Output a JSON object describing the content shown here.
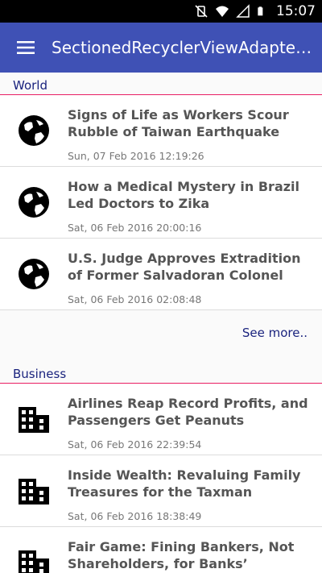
{
  "status_bar": {
    "time": "15:07"
  },
  "app_bar": {
    "title": "SectionedRecyclerViewAdapter..."
  },
  "sections": [
    {
      "title": "World",
      "icon": "globe-icon",
      "items": [
        {
          "title": "Signs of Life as Workers Scour Rubble of Taiwan Earthquake",
          "date": "Sun, 07 Feb 2016 12:19:26"
        },
        {
          "title": "How a Medical Mystery in Brazil Led Doctors to Zika",
          "date": "Sat, 06 Feb 2016 20:00:16"
        },
        {
          "title": "U.S. Judge Approves Extradition of Former Salvadoran Colonel",
          "date": "Sat, 06 Feb 2016 02:08:48"
        }
      ],
      "footer": "See more.."
    },
    {
      "title": "Business",
      "icon": "building-icon",
      "items": [
        {
          "title": "Airlines Reap Record Profits, and Passengers Get Peanuts",
          "date": "Sat, 06 Feb 2016 22:39:54"
        },
        {
          "title": "Inside Wealth: Revaluing Family Treasures for the Taxman",
          "date": "Sat, 06 Feb 2016 18:38:49"
        },
        {
          "title": "Fair Game: Fining Bankers, Not Shareholders, for Banks’ Misconduct",
          "date": ""
        }
      ]
    }
  ]
}
